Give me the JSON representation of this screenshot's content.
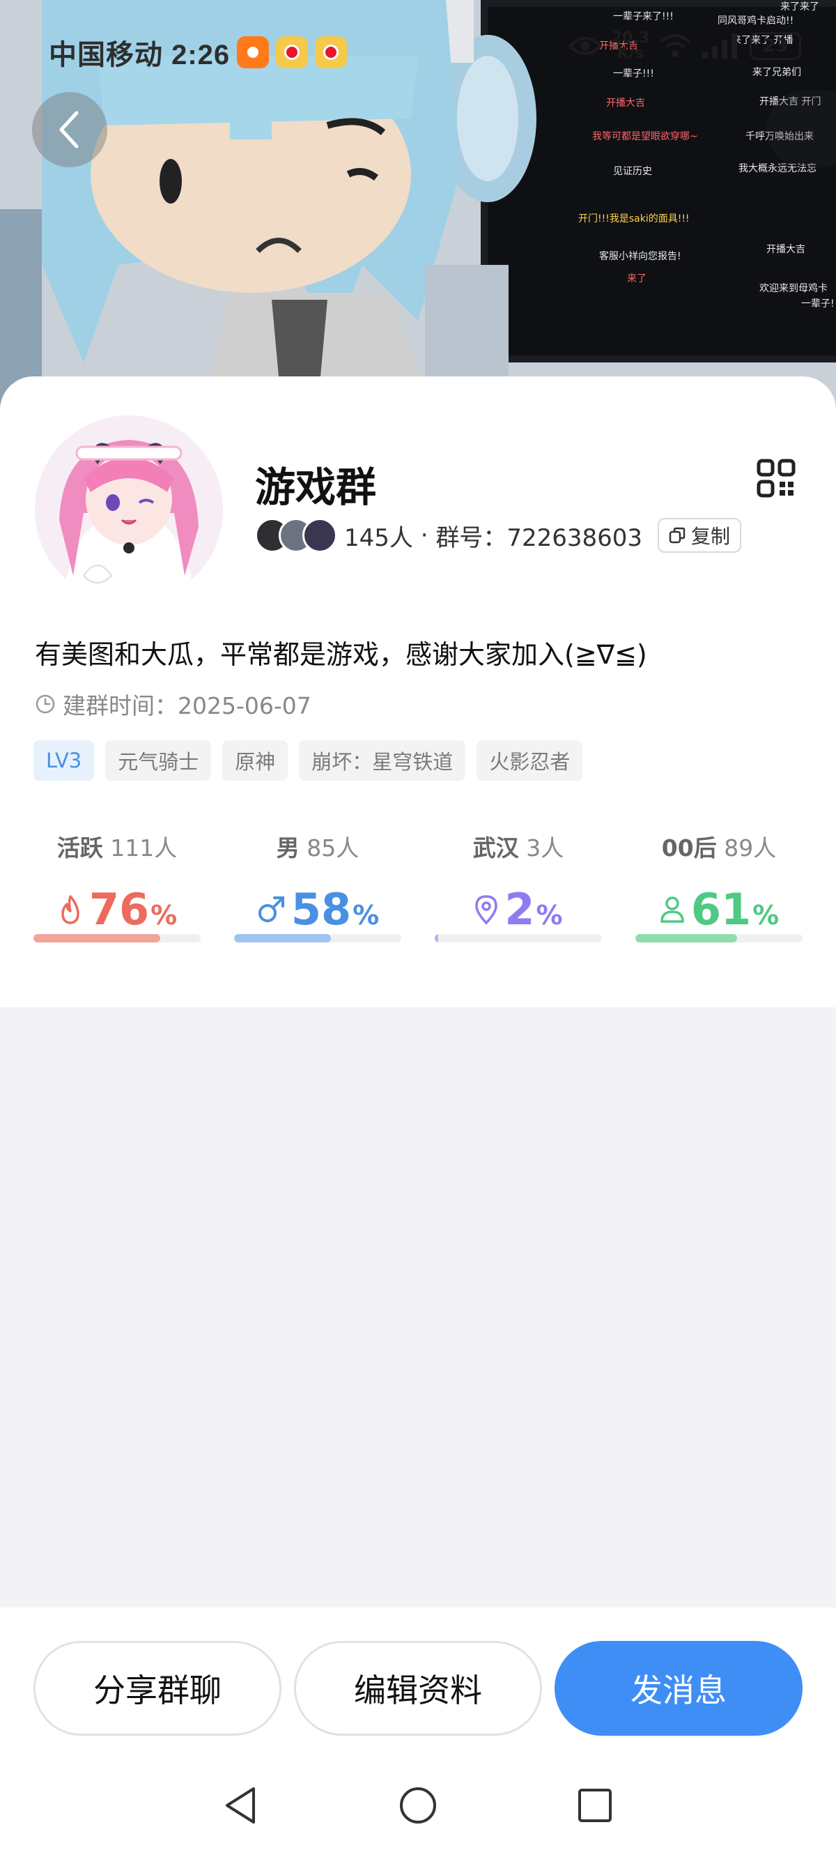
{
  "status_bar": {
    "carrier_time": "中国移动 2:26",
    "speed_value": "20.3",
    "speed_unit": "K/s",
    "battery": "23"
  },
  "group": {
    "name": "游戏群",
    "member_count": "145人",
    "group_number_label": "群号：722638603",
    "copy_label": "复制",
    "description": "有美图和大瓜，平常都是游戏，感谢大家加入(≧∇≦)",
    "created_label": "建群时间：2025-06-07",
    "tags": [
      "LV3",
      "元气骑士",
      "原神",
      "崩坏：星穹铁道",
      "火影忍者"
    ]
  },
  "stats": [
    {
      "label": "活跃",
      "count": "111人",
      "value": "76",
      "unit": "%",
      "fraction": 0.76,
      "color": "#ec6b5e",
      "bar_color": "#f0a49a",
      "icon": "flame-icon"
    },
    {
      "label": "男",
      "count": "85人",
      "value": "58",
      "unit": "%",
      "fraction": 0.58,
      "color": "#4a90e2",
      "bar_color": "#9fc4f1",
      "icon": "male-icon"
    },
    {
      "label": "武汉",
      "count": "3人",
      "value": "2",
      "unit": "%",
      "fraction": 0.02,
      "color": "#8d7cf0",
      "bar_color": "#b9adf6",
      "icon": "location-icon"
    },
    {
      "label": "00后",
      "count": "89人",
      "value": "61",
      "unit": "%",
      "fraction": 0.61,
      "color": "#4fc983",
      "bar_color": "#8fdcae",
      "icon": "person-icon"
    }
  ],
  "actions": {
    "share_label": "分享群聊",
    "edit_label": "编辑资料",
    "send_label": "发消息"
  }
}
